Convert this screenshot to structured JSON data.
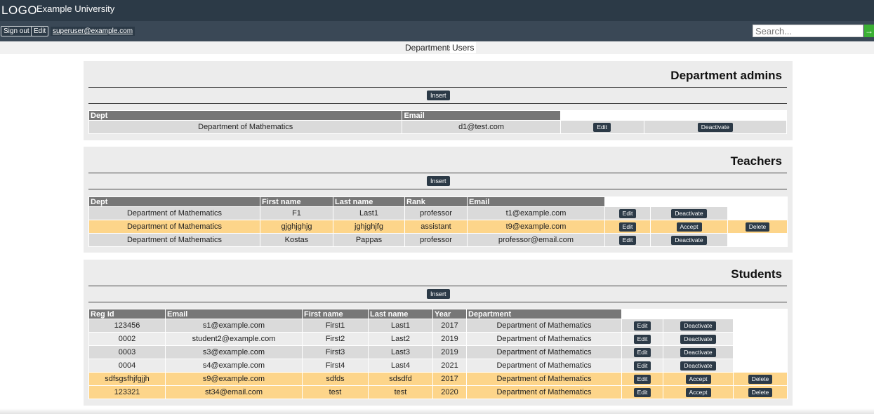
{
  "header": {
    "logo": "LOGO",
    "title": "Example University",
    "sign_out": "Sign out",
    "edit": "Edit",
    "user_email": "superuser@example.com",
    "search_placeholder": "Search...",
    "search_go": "→"
  },
  "nav": {
    "tabs": [
      {
        "label": "Departments"
      },
      {
        "label": "Users"
      }
    ]
  },
  "admins": {
    "title": "Department admins",
    "insert": "Insert",
    "columns": [
      "Dept",
      "Email"
    ],
    "rows": [
      {
        "dept": "Department of Mathematics",
        "email": "d1@test.com",
        "edit": "Edit",
        "action": "Deactivate"
      }
    ]
  },
  "teachers": {
    "title": "Teachers",
    "insert": "Insert",
    "columns": [
      "Dept",
      "First name",
      "Last name",
      "Rank",
      "Email"
    ],
    "rows": [
      {
        "dept": "Department of Mathematics",
        "first": "F1",
        "last": "Last1",
        "rank": "professor",
        "email": "t1@example.com",
        "edit": "Edit",
        "action": "Deactivate",
        "delete": ""
      },
      {
        "dept": "Department of Mathematics",
        "first": "gjghjghjg",
        "last": "jghjghjfg",
        "rank": "assistant",
        "email": "t9@example.com",
        "edit": "Edit",
        "action": "Accept",
        "delete": "Delete"
      },
      {
        "dept": "Department of Mathematics",
        "first": "Kostas",
        "last": "Pappas",
        "rank": "professor",
        "email": "professor@email.com",
        "edit": "Edit",
        "action": "Deactivate",
        "delete": ""
      }
    ]
  },
  "students": {
    "title": "Students",
    "insert": "Insert",
    "columns": [
      "Reg Id",
      "Email",
      "First name",
      "Last name",
      "Year",
      "Department"
    ],
    "rows": [
      {
        "reg": "123456",
        "email": "s1@example.com",
        "first": "First1",
        "last": "Last1",
        "year": "2017",
        "dept": "Department of Mathematics",
        "edit": "Edit",
        "action": "Deactivate",
        "delete": ""
      },
      {
        "reg": "0002",
        "email": "student2@example.com",
        "first": "First2",
        "last": "Last2",
        "year": "2019",
        "dept": "Department of Mathematics",
        "edit": "Edit",
        "action": "Deactivate",
        "delete": ""
      },
      {
        "reg": "0003",
        "email": "s3@example.com",
        "first": "First3",
        "last": "Last3",
        "year": "2019",
        "dept": "Department of Mathematics",
        "edit": "Edit",
        "action": "Deactivate",
        "delete": ""
      },
      {
        "reg": "0004",
        "email": "s4@example.com",
        "first": "First4",
        "last": "Last4",
        "year": "2021",
        "dept": "Department of Mathematics",
        "edit": "Edit",
        "action": "Deactivate",
        "delete": ""
      },
      {
        "reg": "sdfsgsfhjfgjjh",
        "email": "s9@example.com",
        "first": "sdfds",
        "last": "sdsdfd",
        "year": "2017",
        "dept": "Department of Mathematics",
        "edit": "Edit",
        "action": "Accept",
        "delete": "Delete"
      },
      {
        "reg": "123321",
        "email": "st34@email.com",
        "first": "test",
        "last": "test",
        "year": "2020",
        "dept": "Department of Mathematics",
        "edit": "Edit",
        "action": "Accept",
        "delete": "Delete"
      }
    ]
  }
}
